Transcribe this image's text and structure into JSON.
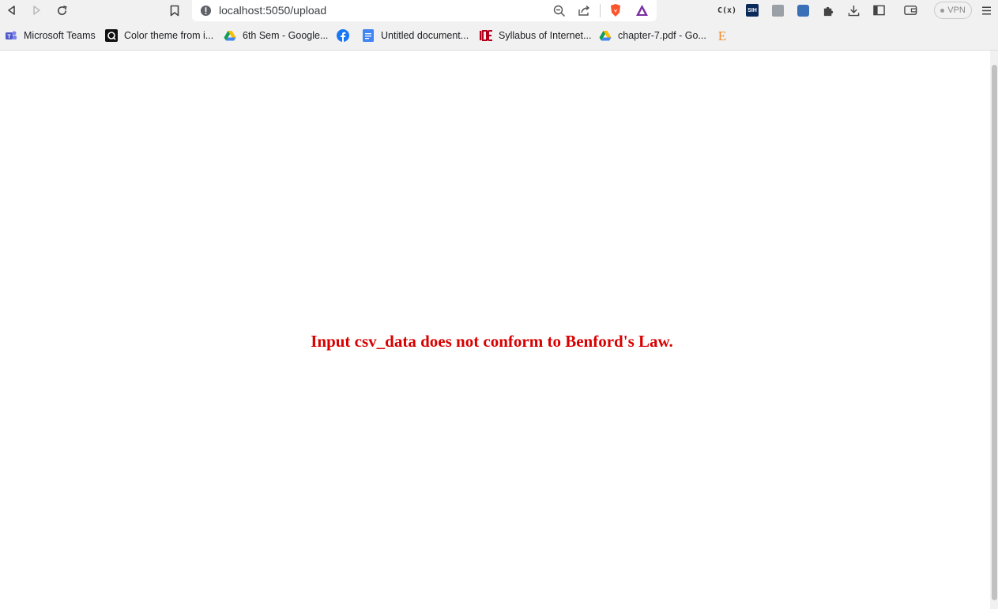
{
  "browser": {
    "url": "localhost:5050/upload",
    "vpn_label": "VPN"
  },
  "bookmarks": [
    {
      "label": "Microsoft Teams",
      "icon": "teams-icon"
    },
    {
      "label": "Color theme from i...",
      "icon": "color-theme-icon"
    },
    {
      "label": "6th Sem - Google...",
      "icon": "google-drive-icon"
    },
    {
      "label": "",
      "icon": "facebook-icon"
    },
    {
      "label": "Untitled document...",
      "icon": "google-docs-icon"
    },
    {
      "label": "Syllabus of Internet...",
      "icon": "ioe-icon"
    },
    {
      "label": "chapter-7.pdf - Go...",
      "icon": "google-drive-icon"
    },
    {
      "label": "",
      "icon": "e-letter-icon"
    }
  ],
  "page": {
    "message": "Input csv_data does not conform to Benford's Law.",
    "message_color": "#d80000"
  },
  "colors": {
    "toolbar_bg": "#f1f1f1",
    "brave_orange": "#fb542b",
    "vpn_gray": "#8a8a8a"
  }
}
